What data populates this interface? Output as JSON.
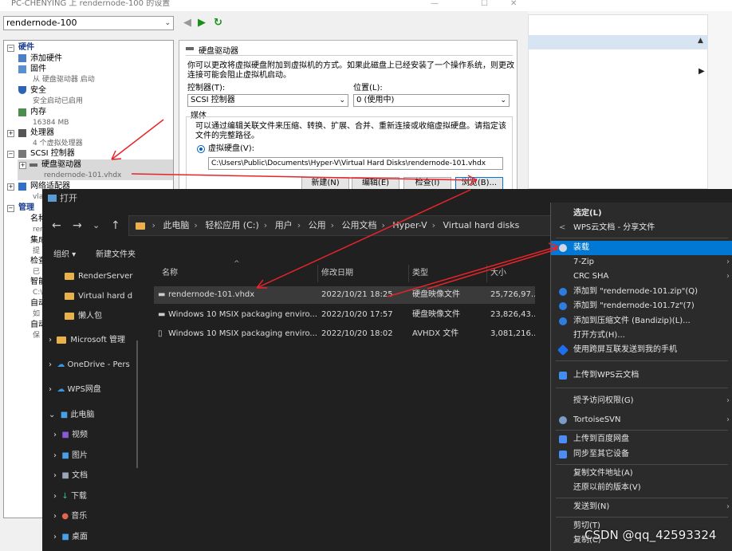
{
  "hyperv": {
    "title": "PC-CHENYING 上 rendernode-100 的设置",
    "vm_selected": "rendernode-100",
    "tree": {
      "hardware_header": "硬件",
      "add_hardware": "添加硬件",
      "firmware": "固件",
      "firmware_sub": "从 硬盘驱动器 启动",
      "security": "安全",
      "security_sub": "安全启动已启用",
      "memory": "内存",
      "memory_sub": "16384 MB",
      "processor": "处理器",
      "processor_sub": "4 个虚拟处理器",
      "scsi": "SCSI 控制器",
      "hdd": "硬盘驱动器",
      "hdd_sub": "rendernode-101.vhdx",
      "network": "网络适配器",
      "network_sub": "vla",
      "management_header": "管理",
      "m1": "名称",
      "m1_sub": "ren",
      "m2": "集成",
      "m2_sub": "提",
      "m3": "检查",
      "m3_sub": "已",
      "m4": "智能",
      "m4_sub": "C:\\",
      "m5": "自动",
      "m5_sub": "如",
      "m6": "自动",
      "m6_sub": "保"
    },
    "panel": {
      "title": "硬盘驱动器",
      "desc_line1": "你可以更改将虚拟硬盘附加到虚拟机的方式。如果此磁盘上已经安装了一个操作系统，则更改",
      "desc_line2": "连接可能会阻止虚拟机启动。",
      "controller_label": "控制器(T):",
      "controller_value": "SCSI 控制器",
      "location_label": "位置(L):",
      "location_value": "0 (使用中)",
      "media_label": "媒体",
      "media_desc1": "可以通过编辑关联文件来压缩、转换、扩展、合并、重新连接或收缩虚拟硬盘。请指定该",
      "media_desc2": "文件的完整路径。",
      "vhd_radio": "虚拟硬盘(V):",
      "vhd_path": "C:\\Users\\Public\\Documents\\Hyper-V\\Virtual Hard Disks\\rendernode-101.vhdx",
      "btn_new": "新建(N)",
      "btn_edit": "编辑(E)",
      "btn_inspect": "检查(I)",
      "btn_browse": "浏览(B)..."
    }
  },
  "dialog": {
    "title": "打开",
    "breadcrumb": [
      "此电脑",
      "轻松应用 (C:)",
      "用户",
      "公用",
      "公用文档",
      "Hyper-V",
      "Virtual hard disks"
    ],
    "toolbar": {
      "organize": "组织",
      "new_folder": "新建文件夹"
    },
    "sidebar": {
      "f1": "RenderServer",
      "f2": "Virtual hard d",
      "f3": "懒人包",
      "ms": "Microsoft 管理",
      "onedrive": "OneDrive - Pers",
      "wps": "WPS网盘",
      "pc": "此电脑",
      "video": "视频",
      "pictures": "图片",
      "docs": "文档",
      "downloads": "下载",
      "music": "音乐",
      "desktop": "桌面"
    },
    "columns": {
      "name": "名称",
      "date": "修改日期",
      "type": "类型",
      "size": "大小"
    },
    "files": [
      {
        "name": "rendernode-101.vhdx",
        "date": "2022/10/21 18:25",
        "type": "硬盘映像文件",
        "size": "25,726,97..."
      },
      {
        "name": "Windows 10 MSIX packaging enviro...",
        "date": "2022/10/20 17:57",
        "type": "硬盘映像文件",
        "size": "23,826,43..."
      },
      {
        "name": "Windows 10 MSIX packaging enviro...",
        "date": "2022/10/20 18:02",
        "type": "AVHDX 文件",
        "size": "3,081,216..."
      }
    ]
  },
  "context_menu": {
    "items": [
      {
        "label": "选定(L)",
        "bold": true
      },
      {
        "label": "WPS云文档 - 分享文件"
      },
      {
        "label": "装载",
        "highlight": true
      },
      {
        "label": "7-Zip",
        "submenu": true
      },
      {
        "label": "CRC SHA",
        "submenu": true
      },
      {
        "label": "添加到 \"rendernode-101.zip\"(Q)"
      },
      {
        "label": "添加到 \"rendernode-101.7z\"(7)"
      },
      {
        "label": "添加到压缩文件 (Bandizip)(L)..."
      },
      {
        "label": "打开方式(H)..."
      },
      {
        "label": "使用跨屏互联发送到我的手机"
      },
      {
        "label": "上传到WPS云文档"
      },
      {
        "label": "授予访问权限(G)",
        "submenu": true
      },
      {
        "label": "TortoiseSVN",
        "submenu": true
      },
      {
        "label": "上传到百度网盘"
      },
      {
        "label": "同步至其它设备"
      },
      {
        "label": "复制文件地址(A)"
      },
      {
        "label": "还原以前的版本(V)"
      },
      {
        "label": "发送到(N)",
        "submenu": true
      },
      {
        "label": "剪切(T)"
      },
      {
        "label": "复制(C)"
      }
    ]
  },
  "watermark": "CSDN @qq_42593324",
  "colors": {
    "arrow": "#e8242a",
    "accent": "#0078d4",
    "folder": "#e8b14b"
  }
}
